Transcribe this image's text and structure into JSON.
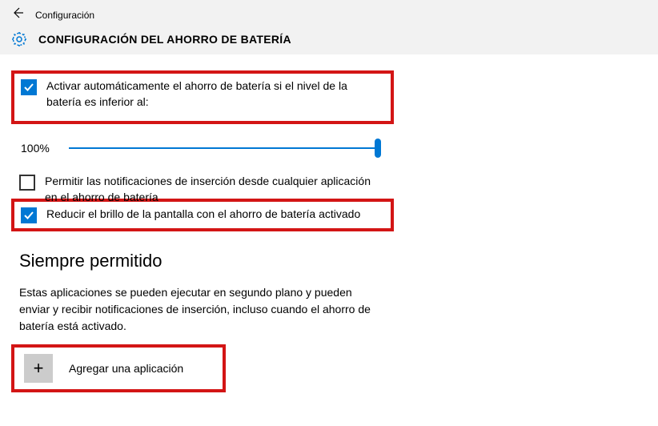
{
  "header": {
    "back_aria": "Back",
    "small_title": "Configuración",
    "page_title": "CONFIGURACIÓN DEL AHORRO DE BATERÍA"
  },
  "settings": {
    "auto_enable": {
      "label": "Activar automáticamente el ahorro de batería si el nivel de la batería es inferior al:",
      "checked": true
    },
    "slider": {
      "value_text": "100%",
      "value": 100
    },
    "allow_notifications": {
      "label": "Permitir las notificaciones de inserción desde cualquier aplicación en el ahorro de batería",
      "checked": false
    },
    "reduce_brightness": {
      "label": "Reducir el brillo de la pantalla con el ahorro de batería activado",
      "checked": true
    }
  },
  "always_allowed": {
    "title": "Siempre permitido",
    "description": "Estas aplicaciones se pueden ejecutar en segundo plano y pueden enviar y recibir notificaciones de inserción, incluso cuando el ahorro de batería está activado.",
    "add_button": "Agregar una aplicación"
  }
}
